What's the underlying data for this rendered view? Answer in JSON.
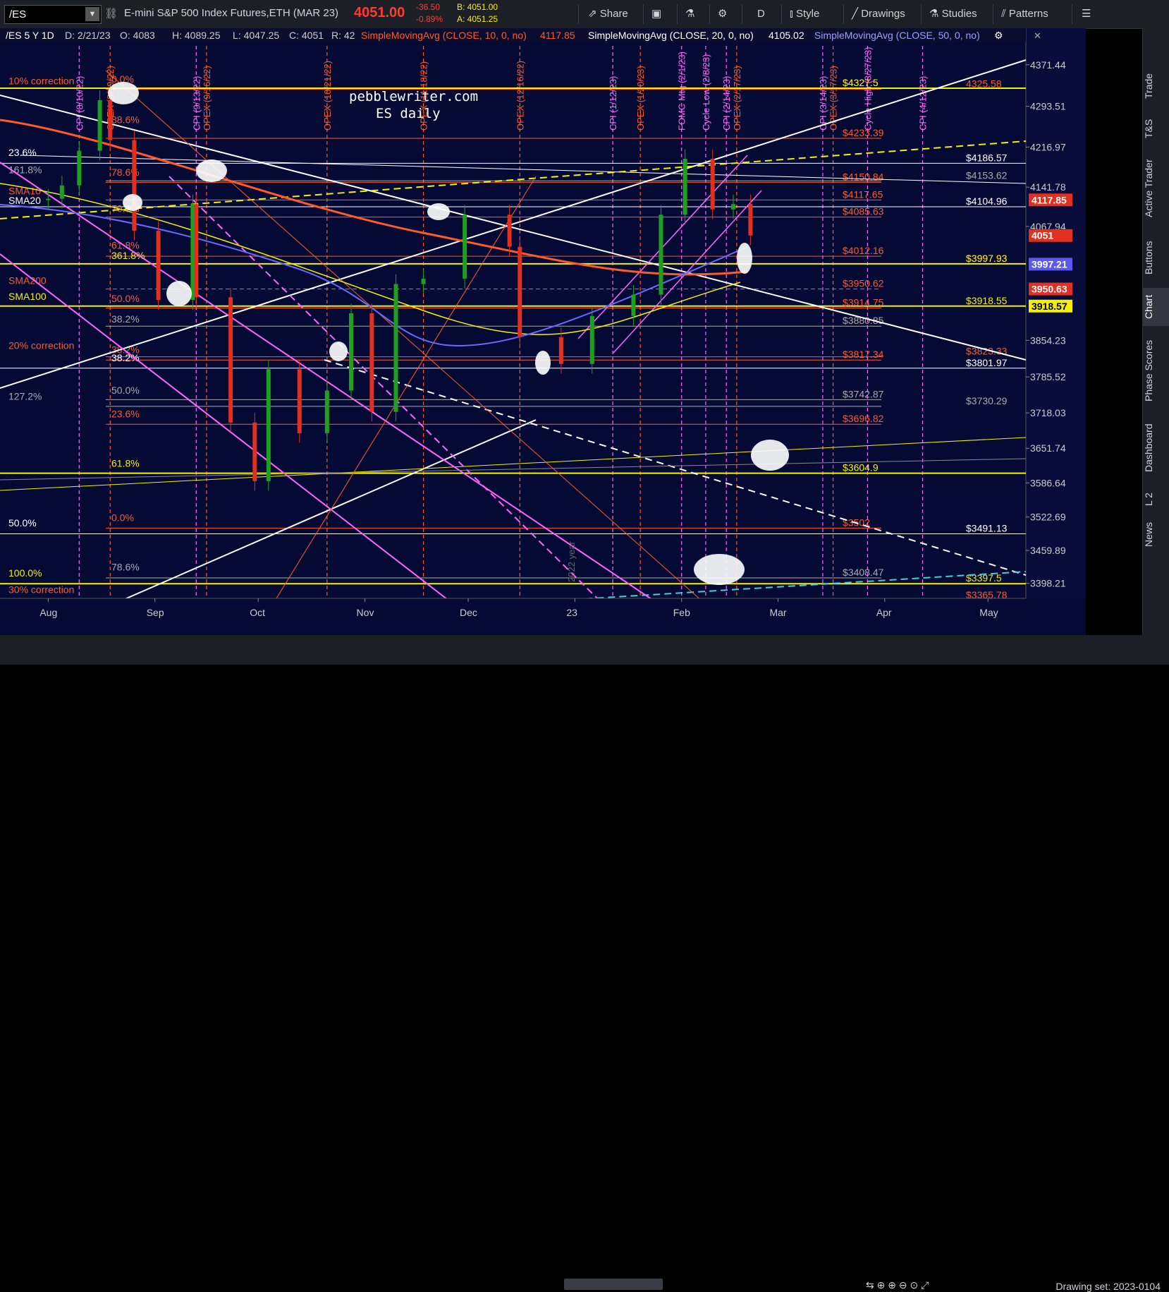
{
  "toolbar": {
    "symbol": "/ES",
    "instrument": "E-mini S&P 500 Index Futures,ETH (MAR 23)",
    "last_price": "4051.00",
    "change": "-36.50",
    "change_pct": "-0.89%",
    "bid": "B: 4051.00",
    "ask": "A: 4051.25",
    "share": "Share",
    "period": "D",
    "style": "Style",
    "drawings": "Drawings",
    "studies": "Studies",
    "patterns": "Patterns"
  },
  "legend": {
    "header": "/ES 5 Y 1D",
    "date": "D: 2/21/23",
    "open": "O: 4083",
    "high": "H: 4089.25",
    "low": "L: 4047.25",
    "close": "C: 4051",
    "range": "R: 42",
    "sma10": "SimpleMovingAvg (CLOSE, 10, 0, no)",
    "sma10_val": "4117.85",
    "sma20": "SimpleMovingAvg (CLOSE, 20, 0, no)",
    "sma20_val": "4105.02",
    "sma50": "SimpleMovingAvg (CLOSE, 50, 0, no)"
  },
  "watermark": {
    "line1": "pebblewriter.com",
    "line2": "ES daily",
    "year": "2022 year"
  },
  "side_tabs": [
    "Trade",
    "T&S",
    "Active Trader",
    "Buttons",
    "Chart",
    "Phase Scores",
    "Dashboard",
    "L 2",
    "News"
  ],
  "footer": {
    "drawing_set": "Drawing set: 2023-0104"
  },
  "colors": {
    "background": "#050a35",
    "orange": "#ff5a2a",
    "yellow": "#f5f000",
    "white": "#ffffff",
    "magenta": "#ff66ff",
    "blue_sma50": "#6a6aff",
    "cyan": "#3fd0e0",
    "candle_up": "#1ea01e",
    "candle_down": "#e03020"
  },
  "chart_data": {
    "type": "candlestick",
    "title": "/ES 5 Y 1D",
    "x_ticks": [
      "Aug",
      "Sep",
      "Oct",
      "Nov",
      "Dec",
      "23",
      "Feb",
      "Mar",
      "Apr",
      "May"
    ],
    "y_ticks": [
      "4371.44",
      "4293.51",
      "4216.97",
      "4141.78",
      "4067.94",
      "3854.23",
      "3785.52",
      "3718.03",
      "3651.74",
      "3586.64",
      "3522.69",
      "3459.89",
      "3398.21"
    ],
    "ylim": [
      3370,
      4440
    ],
    "price_tags": [
      {
        "label": "4117.85",
        "bg": "#e03020"
      },
      {
        "label": "4051",
        "bg": "#e03020"
      },
      {
        "label": "3997.21",
        "bg": "#5a5af0"
      },
      {
        "label": "3950.63",
        "bg": "#e03020"
      },
      {
        "label": "3918.57",
        "bg": "#f5f000"
      }
    ],
    "horizontal_levels": [
      {
        "value": 4325.58,
        "label": "4325.58",
        "color": "#ff5a2a"
      },
      {
        "value": 4327.5,
        "label": "$4327.5",
        "color": "#ff5a2a"
      },
      {
        "value": 4327.5,
        "label": "$4327.5",
        "color": "#f5f000"
      },
      {
        "value": 4233.39,
        "label": "$4233.39",
        "color": "#ff5a2a"
      },
      {
        "value": 4186.57,
        "label": "$4186.57",
        "color": "#ffffff"
      },
      {
        "value": 4153.62,
        "label": "$4153.62",
        "color": "#aaaaaa"
      },
      {
        "value": 4150.84,
        "label": "$4150.84",
        "color": "#ff5a2a"
      },
      {
        "value": 4117.65,
        "label": "$4117.65",
        "color": "#ff5a2a"
      },
      {
        "value": 4104.96,
        "label": "$4104.96",
        "color": "#ffffff"
      },
      {
        "value": 4085.63,
        "label": "$4085.63",
        "color": "#ff5a2a"
      },
      {
        "value": 4012.16,
        "label": "$4012.16",
        "color": "#ff5a2a"
      },
      {
        "value": 3997.93,
        "label": "$3997.93",
        "color": "#ff5a2a"
      },
      {
        "value": 3997.93,
        "label": "$3997.93",
        "color": "#f5f000"
      },
      {
        "value": 3950.62,
        "label": "$3950.62",
        "color": "#ff5a2a"
      },
      {
        "value": 3918.55,
        "label": "$3918.55",
        "color": "#f5f000"
      },
      {
        "value": 3914.75,
        "label": "$3914.75",
        "color": "#ff5a2a"
      },
      {
        "value": 3880.85,
        "label": "$3880.85",
        "color": "#aaaaaa"
      },
      {
        "value": 3823.33,
        "label": "$3823.33",
        "color": "#ff5a2a"
      },
      {
        "value": 3817.34,
        "label": "$3817.34",
        "color": "#ff5a2a"
      },
      {
        "value": 3801.97,
        "label": "$3801.97",
        "color": "#ffffff"
      },
      {
        "value": 3742.87,
        "label": "$3742.87",
        "color": "#aaaaaa"
      },
      {
        "value": 3730.29,
        "label": "$3730.29",
        "color": "#aaaaaa"
      },
      {
        "value": 3696.82,
        "label": "$3696.82",
        "color": "#ff5a2a"
      },
      {
        "value": 3604.9,
        "label": "$3604.9",
        "color": "#f5f000"
      },
      {
        "value": 3502,
        "label": "$3502",
        "color": "#ff5a2a"
      },
      {
        "value": 3491.13,
        "label": "$3491.13",
        "color": "#ffffff"
      },
      {
        "value": 3408.47,
        "label": "$3408.47",
        "color": "#aaaaaa"
      },
      {
        "value": 3397.5,
        "label": "$3397.5",
        "color": "#f5f000"
      },
      {
        "value": 3365.78,
        "label": "$3365.78",
        "color": "#ff5a2a"
      }
    ],
    "fib_labels_left": [
      {
        "label": "0.0%",
        "value": 4338,
        "color": "#ff5a2a"
      },
      {
        "label": "10% correction",
        "value": 4335,
        "color": "#ff5a2a"
      },
      {
        "label": "88.6%",
        "value": 4262,
        "color": "#ff5a2a"
      },
      {
        "label": "23.6%",
        "value": 4200,
        "color": "#ffffff"
      },
      {
        "label": "161.8%",
        "value": 4168,
        "color": "#aaaaaa"
      },
      {
        "label": "78.6%",
        "value": 4163,
        "color": "#ff5a2a"
      },
      {
        "label": "SMA10",
        "value": 4128,
        "color": "#ff5a2a"
      },
      {
        "label": "SMA20",
        "value": 4110,
        "color": "#ffffff"
      },
      {
        "label": "70.7%",
        "value": 4095,
        "color": "#ff5a2a"
      },
      {
        "label": "61.8%",
        "value": 4026,
        "color": "#ff5a2a"
      },
      {
        "label": "361.8%",
        "value": 4007,
        "color": "#f5f000"
      },
      {
        "label": "SMA200",
        "value": 3960,
        "color": "#ff5a2a"
      },
      {
        "label": "SMA100",
        "value": 3930,
        "color": "#f5f000"
      },
      {
        "label": "50.0%",
        "value": 3926,
        "color": "#ff5a2a"
      },
      {
        "label": "38.2%",
        "value": 3888,
        "color": "#aaaaaa"
      },
      {
        "label": "20% correction",
        "value": 3838,
        "color": "#ff5a2a"
      },
      {
        "label": "38.2%",
        "value": 3830,
        "color": "#ff5a2a"
      },
      {
        "label": "38.2%",
        "value": 3815,
        "color": "#ffffff"
      },
      {
        "label": "50.0%",
        "value": 3754,
        "color": "#aaaaaa"
      },
      {
        "label": "127.2%",
        "value": 3743,
        "color": "#aaaaaa"
      },
      {
        "label": "23.6%",
        "value": 3710,
        "color": "#ff5a2a"
      },
      {
        "label": "61.8%",
        "value": 3617,
        "color": "#f5f000"
      },
      {
        "label": "0.0%",
        "value": 3515,
        "color": "#ff5a2a"
      },
      {
        "label": "50.0%",
        "value": 3505,
        "color": "#ffffff"
      },
      {
        "label": "78.6%",
        "value": 3422,
        "color": "#aaaaaa"
      },
      {
        "label": "100.0%",
        "value": 3411,
        "color": "#f5f000"
      },
      {
        "label": "30% correction",
        "value": 3380,
        "color": "#ff5a2a"
      }
    ],
    "event_markers": [
      {
        "label": "CPI (8/10/22)",
        "color": "#ff66ff"
      },
      {
        "label": "OPEX (8/19/22)",
        "color": "#ff5a2a"
      },
      {
        "label": "CPI (9/13/22)",
        "color": "#ff66ff"
      },
      {
        "label": "OPEX (9/16/22)",
        "color": "#ff5a2a"
      },
      {
        "label": "OPEX (10/21/22)",
        "color": "#ff5a2a"
      },
      {
        "label": "OPEX (11/18/22)",
        "color": "#ff5a2a"
      },
      {
        "label": "OPEX (12/16/22)",
        "color": "#ff5a2a"
      },
      {
        "label": "CPI (1/12/23)",
        "color": "#ff66ff"
      },
      {
        "label": "OPEX (1/20/23)",
        "color": "#ff5a2a"
      },
      {
        "label": "FOMC Mtg (2/1/23)",
        "color": "#ff66ff"
      },
      {
        "label": "Cycle Low (2/8/23)",
        "color": "#ff66ff"
      },
      {
        "label": "CPI (2/14/23)",
        "color": "#ff66ff"
      },
      {
        "label": "OPEX (2/17/23)",
        "color": "#ff5a2a"
      },
      {
        "label": "CPI (3/14/23)",
        "color": "#ff66ff"
      },
      {
        "label": "OPEX (3/17/23)",
        "color": "#ff5a2a"
      },
      {
        "label": "Cycle High (3/27/23)",
        "color": "#ff66ff"
      },
      {
        "label": "CPI (4/12/23)",
        "color": "#ff66ff"
      }
    ],
    "close_series": [
      {
        "date": "2022-08-01",
        "close": 4120
      },
      {
        "date": "2022-08-05",
        "close": 4145
      },
      {
        "date": "2022-08-10",
        "close": 4210
      },
      {
        "date": "2022-08-16",
        "close": 4305
      },
      {
        "date": "2022-08-19",
        "close": 4230
      },
      {
        "date": "2022-08-26",
        "close": 4060
      },
      {
        "date": "2022-09-02",
        "close": 3930
      },
      {
        "date": "2022-09-12",
        "close": 4110
      },
      {
        "date": "2022-09-13",
        "close": 3935
      },
      {
        "date": "2022-09-23",
        "close": 3700
      },
      {
        "date": "2022-09-30",
        "close": 3590
      },
      {
        "date": "2022-10-04",
        "close": 3800
      },
      {
        "date": "2022-10-13",
        "close": 3680
      },
      {
        "date": "2022-10-21",
        "close": 3760
      },
      {
        "date": "2022-10-28",
        "close": 3905
      },
      {
        "date": "2022-11-03",
        "close": 3720
      },
      {
        "date": "2022-11-10",
        "close": 3960
      },
      {
        "date": "2022-11-18",
        "close": 3970
      },
      {
        "date": "2022-11-30",
        "close": 4090
      },
      {
        "date": "2022-12-13",
        "close": 4030
      },
      {
        "date": "2022-12-16",
        "close": 3860
      },
      {
        "date": "2022-12-28",
        "close": 3810
      },
      {
        "date": "2023-01-06",
        "close": 3900
      },
      {
        "date": "2023-01-18",
        "close": 3940
      },
      {
        "date": "2023-01-26",
        "close": 4090
      },
      {
        "date": "2023-02-02",
        "close": 4195
      },
      {
        "date": "2023-02-10",
        "close": 4100
      },
      {
        "date": "2023-02-16",
        "close": 4110
      },
      {
        "date": "2023-02-21",
        "close": 4051
      }
    ]
  }
}
